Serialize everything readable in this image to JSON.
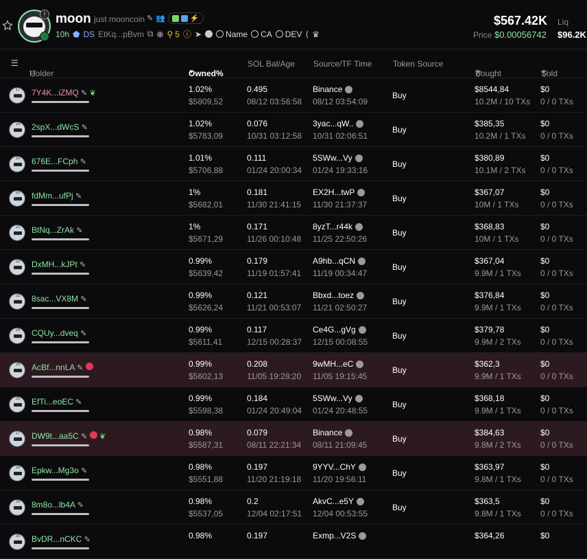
{
  "token": {
    "name": "moon",
    "subtitle": "just mooncoin",
    "age": "10h",
    "ds": "DS",
    "address": "EtKq...pBvm",
    "holders_count": "5",
    "search_name": "Name",
    "search_ca": "CA",
    "search_dev": "DEV",
    "market_cap": "$567.42K",
    "liq_label": "Liq",
    "price_label": "Price",
    "price": "$0.00056742",
    "liq_value": "$96.2K",
    "colors": {
      "accent_green": "#8fe3a0",
      "pink": "#f08fb0",
      "highlight_row": "#2d1a20"
    }
  },
  "table": {
    "headers": {
      "holder": "Holder",
      "owned": "Owned%",
      "sol": "SOL Bal/Age",
      "source": "Source/TF Time",
      "token_source": "Token Source",
      "bought": "Bought",
      "sold": "Sold"
    },
    "rows": [
      {
        "rank": "17",
        "name": "7Y4K...iZMQ",
        "pink": true,
        "flag": false,
        "leaf": true,
        "pct": "1.02%",
        "usd": "$5809,52",
        "sol": "0.495",
        "age": "08/12 03:56:58",
        "src": "Binance",
        "srctime": "08/12 03:54:09",
        "tsrc": "Buy",
        "bought": "$8544,84",
        "bought_sub": "10.2M / 10 TXs",
        "sold": "$0",
        "sold_sub": "0 / 0 TXs",
        "hl": false
      },
      {
        "rank": "18",
        "name": "2spX...dWcS",
        "pink": false,
        "flag": false,
        "leaf": false,
        "pct": "1.02%",
        "usd": "$5783,09",
        "sol": "0.076",
        "age": "10/31 03:12:58",
        "src": "3yac...qW..",
        "srctime": "10/31 02:06:51",
        "tsrc": "Buy",
        "bought": "$385,35",
        "bought_sub": "10.2M / 1 TXs",
        "sold": "$0",
        "sold_sub": "0 / 0 TXs",
        "hl": false
      },
      {
        "rank": "19",
        "name": "676E...FCph",
        "pink": false,
        "flag": false,
        "leaf": false,
        "pct": "1.01%",
        "usd": "$5706,88",
        "sol": "0.111",
        "age": "01/24 20:00:34",
        "src": "5SWw...Vy",
        "srctime": "01/24 19:33:16",
        "tsrc": "Buy",
        "bought": "$380,89",
        "bought_sub": "10.1M / 2 TXs",
        "sold": "$0",
        "sold_sub": "0 / 0 TXs",
        "hl": false
      },
      {
        "rank": "20",
        "name": "fdMm...ufPj",
        "pink": false,
        "flag": false,
        "leaf": false,
        "pct": "1%",
        "usd": "$5682,01",
        "sol": "0.181",
        "age": "11/30 21:41:15",
        "src": "EX2H...twP",
        "srctime": "11/30 21:37:37",
        "tsrc": "Buy",
        "bought": "$367,07",
        "bought_sub": "10M / 1 TXs",
        "sold": "$0",
        "sold_sub": "0 / 0 TXs",
        "hl": false
      },
      {
        "rank": "21",
        "name": "BtNq...ZrAk",
        "pink": false,
        "flag": false,
        "leaf": false,
        "pct": "1%",
        "usd": "$5671,29",
        "sol": "0.171",
        "age": "11/26 00:10:48",
        "src": "8yzT...r44k",
        "srctime": "11/25 22:50:26",
        "tsrc": "Buy",
        "bought": "$368,83",
        "bought_sub": "10M / 1 TXs",
        "sold": "$0",
        "sold_sub": "0 / 0 TXs",
        "hl": false
      },
      {
        "rank": "22",
        "name": "DxMH...kJPt",
        "pink": false,
        "flag": false,
        "leaf": false,
        "pct": "0.99%",
        "usd": "$5639,42",
        "sol": "0.179",
        "age": "11/19 01:57:41",
        "src": "A9hb...qCN",
        "srctime": "11/19 00:34:47",
        "tsrc": "Buy",
        "bought": "$367,04",
        "bought_sub": "9.9M / 1 TXs",
        "sold": "$0",
        "sold_sub": "0 / 0 TXs",
        "hl": false
      },
      {
        "rank": "23",
        "name": "8sac...VX8M",
        "pink": false,
        "flag": false,
        "leaf": false,
        "pct": "0.99%",
        "usd": "$5626,24",
        "sol": "0.121",
        "age": "11/21 00:53:07",
        "src": "Bbxd...toez",
        "srctime": "11/21 02:50:27",
        "tsrc": "Buy",
        "bought": "$376,84",
        "bought_sub": "9.9M / 1 TXs",
        "sold": "$0",
        "sold_sub": "0 / 0 TXs",
        "hl": false
      },
      {
        "rank": "24",
        "name": "CQUy...dveq",
        "pink": false,
        "flag": false,
        "leaf": false,
        "pct": "0.99%",
        "usd": "$5611,41",
        "sol": "0.117",
        "age": "12/15 00:28:37",
        "src": "Ce4G...gVg",
        "srctime": "12/15 00:08:55",
        "tsrc": "Buy",
        "bought": "$379,78",
        "bought_sub": "9.9M / 2 TXs",
        "sold": "$0",
        "sold_sub": "0 / 0 TXs",
        "hl": false
      },
      {
        "rank": "25",
        "name": "AcBf...nnLA",
        "pink": false,
        "flag": true,
        "leaf": false,
        "pct": "0.99%",
        "usd": "$5602,13",
        "sol": "0.208",
        "age": "11/05 19:28:20",
        "src": "9wMH...eC",
        "srctime": "11/05 19:15:45",
        "tsrc": "Buy",
        "bought": "$362,3",
        "bought_sub": "9.9M / 1 TXs",
        "sold": "$0",
        "sold_sub": "0 / 0 TXs",
        "hl": true
      },
      {
        "rank": "26",
        "name": "EfTi...eoEC",
        "pink": false,
        "flag": false,
        "leaf": false,
        "pct": "0.99%",
        "usd": "$5598,38",
        "sol": "0.184",
        "age": "01/24 20:49:04",
        "src": "5SWw...Vy",
        "srctime": "01/24 20:48:55",
        "tsrc": "Buy",
        "bought": "$368,18",
        "bought_sub": "9.9M / 1 TXs",
        "sold": "$0",
        "sold_sub": "0 / 0 TXs",
        "hl": false
      },
      {
        "rank": "27",
        "name": "DW9t...aa5C",
        "pink": false,
        "flag": true,
        "leaf": true,
        "pct": "0.98%",
        "usd": "$5587,31",
        "sol": "0.079",
        "age": "08/11 22:21:34",
        "src": "Binance",
        "srctime": "08/11 21:09:45",
        "tsrc": "Buy",
        "bought": "$384,63",
        "bought_sub": "9.8M / 2 TXs",
        "sold": "$0",
        "sold_sub": "0 / 0 TXs",
        "hl": true
      },
      {
        "rank": "28",
        "name": "Epkw...Mg3o",
        "pink": false,
        "flag": false,
        "leaf": false,
        "pct": "0.98%",
        "usd": "$5551,88",
        "sol": "0.197",
        "age": "11/20 21:19:18",
        "src": "9YYV...ChY",
        "srctime": "11/20 19:56:11",
        "tsrc": "Buy",
        "bought": "$363,97",
        "bought_sub": "9.8M / 1 TXs",
        "sold": "$0",
        "sold_sub": "0 / 0 TXs",
        "hl": false
      },
      {
        "rank": "29",
        "name": "8m8o...lb4A",
        "pink": false,
        "flag": false,
        "leaf": false,
        "pct": "0.98%",
        "usd": "$5537,05",
        "sol": "0.2",
        "age": "12/04 02:17:51",
        "src": "AkvC...e5Y",
        "srctime": "12/04 00:53:55",
        "tsrc": "Buy",
        "bought": "$363,5",
        "bought_sub": "9.8M / 1 TXs",
        "sold": "$0",
        "sold_sub": "0 / 0 TXs",
        "hl": false
      },
      {
        "rank": "30",
        "name": "BvDR...nCKC",
        "pink": false,
        "flag": false,
        "leaf": false,
        "pct": "0.98%",
        "usd": "",
        "sol": "0.197",
        "age": "",
        "src": "Exmp...V2S",
        "srctime": "",
        "tsrc": "",
        "bought": "$364,26",
        "bought_sub": "",
        "sold": "$0",
        "sold_sub": "",
        "hl": false
      }
    ]
  }
}
